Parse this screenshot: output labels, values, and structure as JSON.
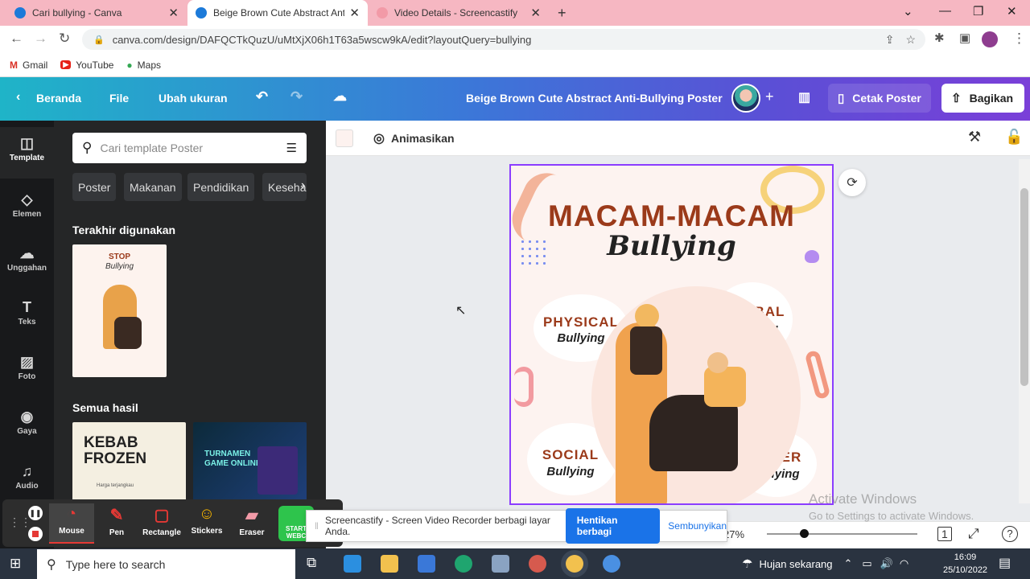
{
  "browser": {
    "tabs": [
      {
        "title": "Cari bullying - Canva",
        "active": false,
        "color": "#1c7ad9"
      },
      {
        "title": "Beige Brown Cute Abstract Anti-B",
        "active": true,
        "color": "#1c7ad9"
      },
      {
        "title": "Video Details - Screencastify",
        "active": false,
        "color": "#f29aa7"
      }
    ],
    "url": "canva.com/design/DAFQCTkQuzU/uMtXjX06h1T63a5wscw9kA/edit?layoutQuery=bullying",
    "bookmarks": [
      "Gmail",
      "YouTube",
      "Maps"
    ]
  },
  "canva_header": {
    "home": "Beranda",
    "file": "File",
    "resize": "Ubah ukuran",
    "title": "Beige Brown Cute Abstract Anti-Bullying Poster",
    "print": "Cetak Poster",
    "share": "Bagikan"
  },
  "rail": [
    "Template",
    "Elemen",
    "Unggahan",
    "Teks",
    "Foto",
    "Gaya",
    "Audio"
  ],
  "panel": {
    "search_placeholder": "Cari template Poster",
    "chips": [
      "Poster",
      "Makanan",
      "Pendidikan",
      "Keseha"
    ],
    "recent_heading": "Terakhir digunakan",
    "all_heading": "Semua hasil",
    "recent_thumb": {
      "title": "STOP",
      "subtitle": "Bullying"
    },
    "result1": {
      "line1": "KEBAB",
      "line2": "FROZEN",
      "small": "Harga terjangkau"
    },
    "result2": {
      "line1": "TURNAMEN",
      "line2": "GAME ONLINE"
    }
  },
  "toolbar2": {
    "animate": "Animasikan"
  },
  "poster": {
    "title": "MACAM-MACAM",
    "subtitle": "Bullying",
    "labels": [
      {
        "type": "PHYSICAL",
        "word": "Bullying"
      },
      {
        "type": "VERBAL",
        "word": "Bullying"
      },
      {
        "type": "SOCIAL",
        "word": "Bullying"
      },
      {
        "type": "CYBER",
        "word": "Bullying"
      }
    ]
  },
  "watermark": {
    "line1": "Activate Windows",
    "line2": "Go to Settings to activate Windows."
  },
  "zoom": {
    "value": "27%",
    "page": "1",
    "slider_fraction": 0.22
  },
  "screencastify": {
    "tools": [
      "Mouse",
      "Pen",
      "Rectangle",
      "Stickers",
      "Eraser"
    ],
    "webcam": "START WEBC",
    "notice": "Screencastify - Screen Video Recorder berbagi layar Anda.",
    "stop": "Hentikan berbagi",
    "hide": "Sembunyikan"
  },
  "taskbar": {
    "search_placeholder": "Type here to search",
    "weather": "Hujan sekarang",
    "time": "16:09",
    "date": "25/10/2022"
  }
}
